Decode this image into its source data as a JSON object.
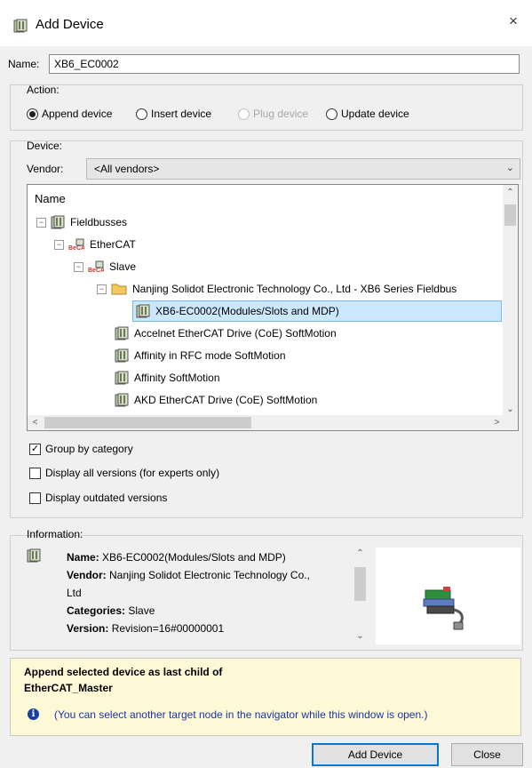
{
  "window": {
    "title": "Add Device",
    "close_label": "×"
  },
  "name": {
    "label": "Name:",
    "value": "XB6_EC0002"
  },
  "action": {
    "label": "Action:",
    "options": [
      {
        "label": "Append device",
        "selected": true,
        "enabled": true
      },
      {
        "label": "Insert device",
        "selected": false,
        "enabled": true
      },
      {
        "label": "Plug device",
        "selected": false,
        "enabled": false
      },
      {
        "label": "Update device",
        "selected": false,
        "enabled": true
      }
    ]
  },
  "device": {
    "label": "Device:",
    "vendor_label": "Vendor:",
    "vendor_value": "<All vendors>",
    "tree_header": "Name",
    "tree": [
      "Fieldbusses",
      "EtherCAT",
      "Slave",
      "Nanjing Solidot Electronic Technology Co., Ltd - XB6 Series Fieldbus",
      "XB6-EC0002(Modules/Slots and MDP)",
      "Accelnet EtherCAT Drive (CoE) SoftMotion",
      "Affinity in RFC mode SoftMotion",
      "Affinity SoftMotion",
      "AKD EtherCAT Drive (CoE) SoftMotion"
    ],
    "selected_item": "XB6-EC0002(Modules/Slots and MDP)"
  },
  "options": {
    "group_by_category": {
      "label": "Group by category",
      "checked": true
    },
    "display_all_versions": {
      "label": "Display all versions (for experts only)",
      "checked": false
    },
    "display_outdated": {
      "label": "Display outdated versions",
      "checked": false
    }
  },
  "information": {
    "label": "Information:",
    "name_key": "Name:",
    "name_val": "XB6-EC0002(Modules/Slots and MDP)",
    "vendor_key": "Vendor:",
    "vendor_val": "Nanjing Solidot Electronic Technology Co.,",
    "vendor_val2": "Ltd",
    "categories_key": "Categories:",
    "categories_val": "Slave",
    "version_key": "Version:",
    "version_val": "Revision=16#00000001"
  },
  "message": {
    "line1": "Append selected device as last child of",
    "line2": "EtherCAT_Master",
    "info_glyph": "i",
    "hint": "(You can select another target node in the navigator while this window is open.)"
  },
  "buttons": {
    "add": "Add Device",
    "close": "Close"
  },
  "colors": {
    "selection": "#cce8ff",
    "hint_text": "#1a34a8",
    "message_bg": "#fdf9d7",
    "default_button_border": "#0078d7"
  }
}
